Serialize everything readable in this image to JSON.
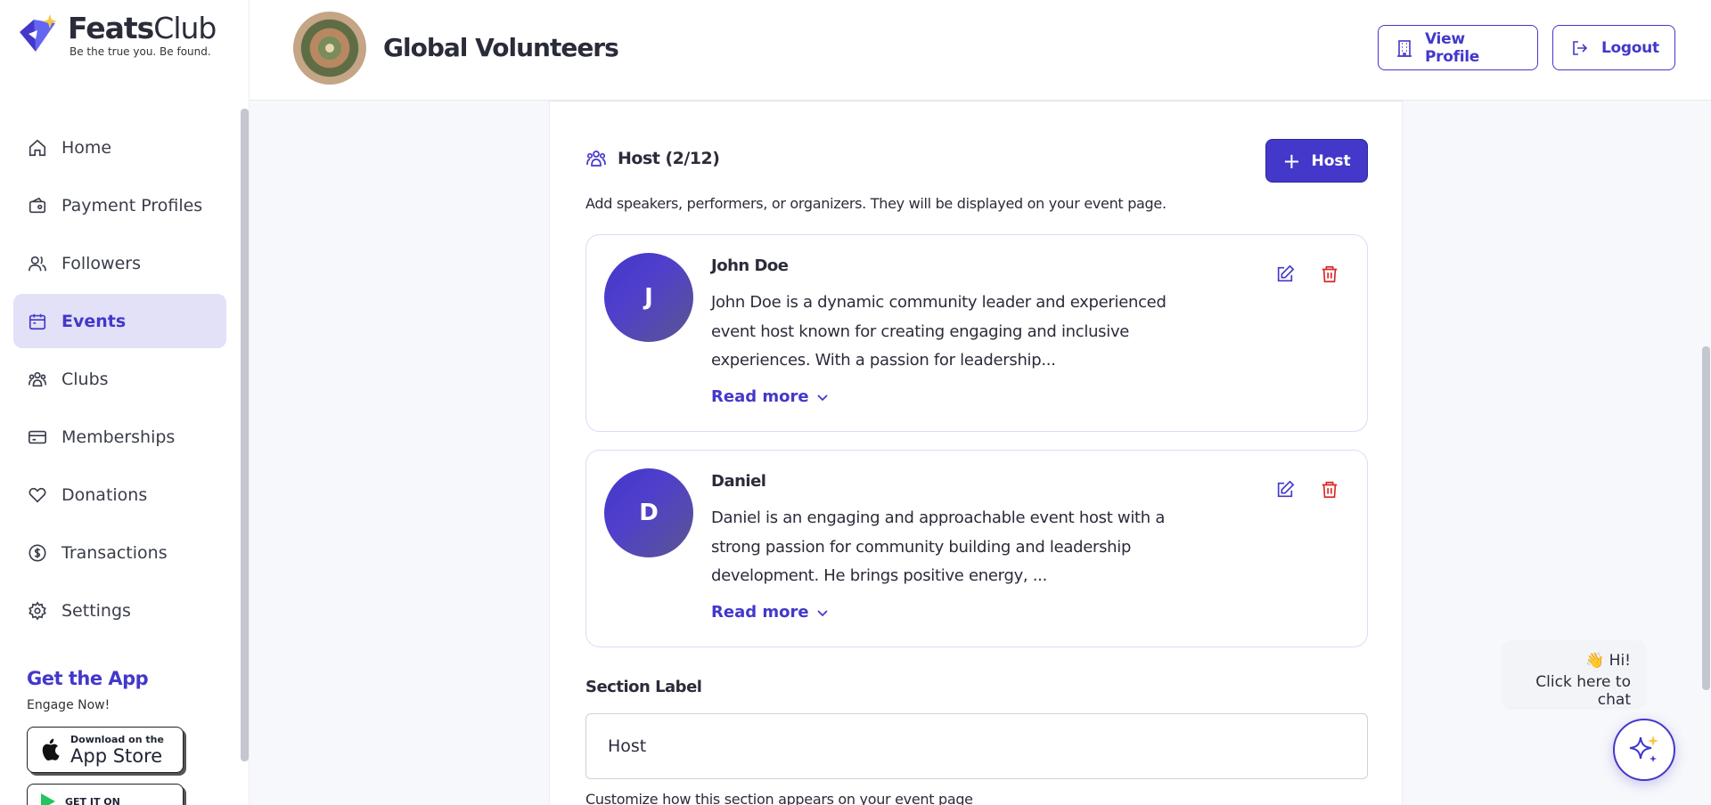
{
  "brand": {
    "name_part1": "Feats",
    "name_part2": "Club",
    "tagline": "Be the true you. Be found."
  },
  "sidebar": {
    "items": [
      {
        "label": "Home",
        "icon": "home-icon"
      },
      {
        "label": "Payment Profiles",
        "icon": "wallet-icon"
      },
      {
        "label": "Followers",
        "icon": "users-icon"
      },
      {
        "label": "Events",
        "icon": "calendar-icon",
        "active": true
      },
      {
        "label": "Clubs",
        "icon": "group-icon"
      },
      {
        "label": "Memberships",
        "icon": "card-icon"
      },
      {
        "label": "Donations",
        "icon": "heart-icon"
      },
      {
        "label": "Transactions",
        "icon": "dollar-circle-icon"
      },
      {
        "label": "Settings",
        "icon": "gear-icon"
      }
    ],
    "get_app": {
      "title": "Get the App",
      "subtitle": "Engage Now!",
      "app_store_small": "Download on the",
      "app_store_big": "App Store",
      "play_store_small": "GET IT ON"
    }
  },
  "header": {
    "title": "Global Volunteers",
    "view_profile_label": "View Profile",
    "logout_label": "Logout"
  },
  "host_section": {
    "title": "Host (2/12)",
    "add_button_label": "Host",
    "description": "Add speakers, performers, or organizers. They will be displayed on your event page.",
    "hosts": [
      {
        "initial": "J",
        "name": "John Doe",
        "bio": "John Doe is a dynamic community leader and experienced event host known for creating engaging and inclusive experiences. With a passion for leadership...",
        "read_more": "Read more"
      },
      {
        "initial": "D",
        "name": "Daniel",
        "bio": "Daniel is an engaging and approachable event host with a strong passion for community building and leadership development. He brings positive energy, ...",
        "read_more": "Read more"
      }
    ],
    "section_label": {
      "label": "Section Label",
      "value": "Host",
      "help": "Customize how this section appears on your event page"
    }
  },
  "chat": {
    "greeting": "👋 Hi!",
    "cta": "Click here to chat"
  },
  "colors": {
    "accent": "#4338ca",
    "active_nav_bg": "#e2e1f7",
    "danger": "#dc2626"
  }
}
